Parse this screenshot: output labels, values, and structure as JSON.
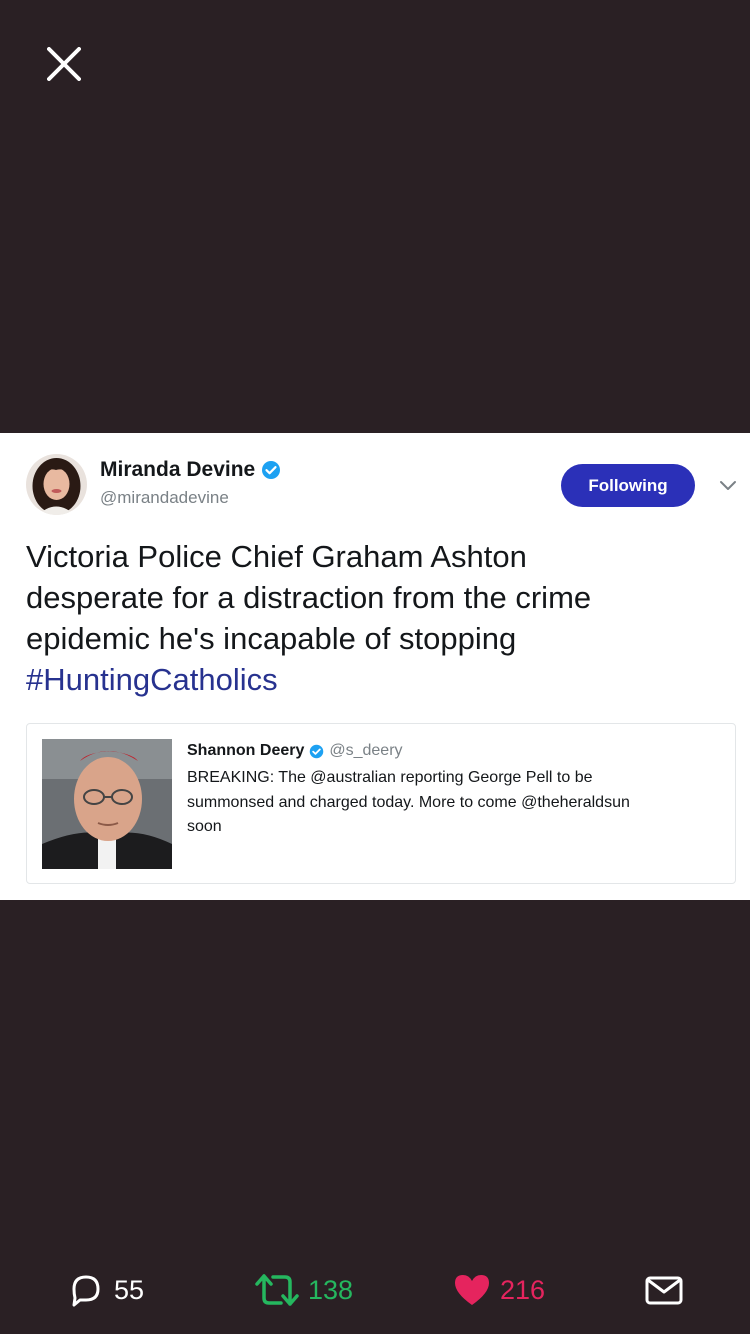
{
  "colors": {
    "background": "#2a2024",
    "follow_button": "#2b30b8",
    "hashtag": "#27328f",
    "retweet": "#25b75f",
    "like": "#e5245e",
    "verified": "#1da1f2"
  },
  "icons": {
    "close": "close-icon",
    "verified": "verified-badge-icon",
    "reply": "reply-icon",
    "retweet": "retweet-icon",
    "like": "heart-icon",
    "message": "envelope-icon"
  },
  "tweet": {
    "author_name": "Miranda Devine",
    "author_handle": "@mirandadevine",
    "follow_label": "Following",
    "text_lines": [
      "Victoria Police Chief Graham Ashton",
      "desperate for a distraction from the crime",
      "epidemic he's incapable of stopping"
    ],
    "hashtag": "#HuntingCatholics"
  },
  "quote": {
    "author_name": "Shannon Deery",
    "author_handle": "@s_deery",
    "text_lines": [
      "BREAKING: The @australian reporting George Pell to be",
      "summonsed and charged today. More to come @theheraldsun",
      "soon"
    ]
  },
  "actions": {
    "reply_count": "55",
    "retweet_count": "138",
    "like_count": "216"
  }
}
